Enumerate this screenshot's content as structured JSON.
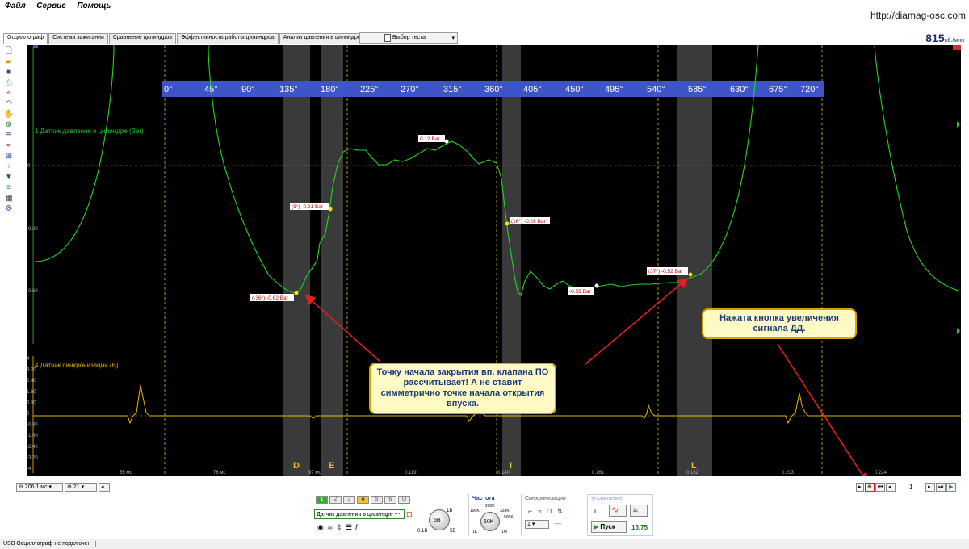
{
  "menu": [
    "Файл",
    "Сервис",
    "Помощь"
  ],
  "url": "http://diamag-osc.com",
  "tabs": [
    "Осциллограф",
    "Система зажигания",
    "Сравнение цилиндров",
    "Эффективность работы цилиндров",
    "Анализ давления в цилиндре"
  ],
  "test_select": "Выбор теста",
  "rpm": {
    "value": "815",
    "unit": "об./мин"
  },
  "degrees": [
    "0°",
    "45°",
    "90°",
    "135°",
    "180°",
    "225°",
    "270°",
    "315°",
    "360°",
    "405°",
    "450°",
    "495°",
    "540°",
    "585°",
    "630°",
    "675°",
    "720°"
  ],
  "channel1": {
    "label": "1 Датчик давления в цилиндре (Bar)",
    "ticks": [
      "0",
      "-0.30",
      "-0.60"
    ],
    "color": "#22cc22"
  },
  "channel4": {
    "label": "4 Датчик синхронизации (В)",
    "ticks": [
      "4",
      "3.20",
      "2.40",
      "1.60",
      "0.80",
      "0",
      "-0.80",
      "-1.60",
      "-2.40",
      "-3.20",
      "-4"
    ],
    "color": "#e6b800"
  },
  "markers": [
    "0.12 Bar",
    "(3°) -0.21 Bar",
    "(16°) -0.28 Bar",
    "-0.59 Bar",
    "(37°) -0.52 Bar",
    "(-36°) -0.62 Bar"
  ],
  "phases": [
    "D",
    "E",
    "I",
    "L"
  ],
  "x_ticks": [
    "55 мс",
    "76 мс",
    "97 мс",
    "0.119",
    "0.140",
    "0.161",
    "0.182",
    "0.203",
    "0.224"
  ],
  "callouts": {
    "main": "Точку начала закрытия вп. клапана ПО рассчитывает! А не ставит симметрично точке начала открытия впуска.",
    "zoom": "Нажата кнопка увеличения сигнала ДД."
  },
  "bottom": {
    "timebase": "206.1 мс",
    "zoom": "21",
    "page": "1"
  },
  "controls": {
    "channel_numbers": [
      "1",
      "2",
      "3",
      "4",
      "5",
      "6",
      "D"
    ],
    "channel_select": "Датчик давления в цилиндре",
    "range_labels": [
      "1B",
      "5B",
      "0.1B"
    ],
    "range_knob": "5B",
    "freq_title": "Частота",
    "freq_labels": [
      "250K",
      "333K",
      "500K",
      "100K",
      "1K",
      "1M"
    ],
    "freq_knob": "50K",
    "sync_title": "Синхронизация",
    "sync_value": "1",
    "control_title": "Управление",
    "start_button": "Пуск",
    "fps": "15.75"
  },
  "status": "USB Осциллограф не подключен"
}
